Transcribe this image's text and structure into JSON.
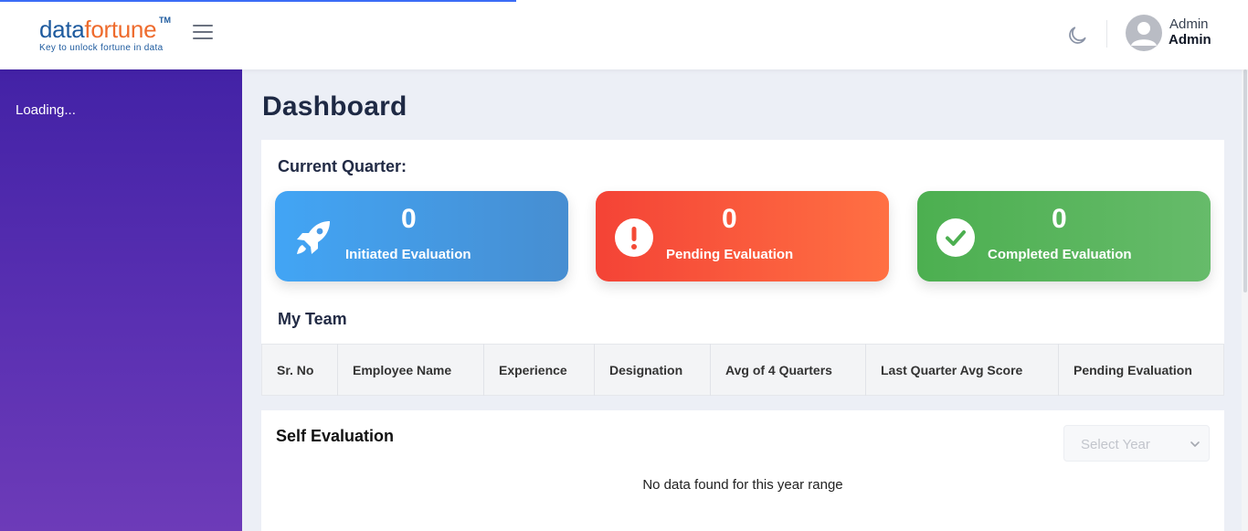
{
  "header": {
    "logo": {
      "brand_part1": "data",
      "brand_part2": "fortune",
      "trademark": "TM",
      "tagline": "Key to unlock fortune in data"
    },
    "user": {
      "name": "Admin",
      "role": "Admin"
    }
  },
  "sidebar": {
    "loading_text": "Loading..."
  },
  "page": {
    "title": "Dashboard"
  },
  "current_quarter": {
    "heading": "Current Quarter:",
    "cards": [
      {
        "count": "0",
        "label": "Initiated Evaluation",
        "color": "#42a5f5",
        "icon": "rocket-icon"
      },
      {
        "count": "0",
        "label": "Pending Evaluation",
        "color": "#f44336",
        "icon": "exclamation-icon"
      },
      {
        "count": "0",
        "label": "Completed Evaluation",
        "color": "#4caf50",
        "icon": "check-icon"
      }
    ]
  },
  "my_team": {
    "heading": "My Team",
    "columns": [
      "Sr. No",
      "Employee Name",
      "Experience",
      "Designation",
      "Avg of 4 Quarters",
      "Last Quarter Avg Score",
      "Pending Evaluation"
    ]
  },
  "self_evaluation": {
    "heading": "Self Evaluation",
    "year_select_placeholder": "Select Year",
    "empty_message": "No data found for this year range"
  }
}
